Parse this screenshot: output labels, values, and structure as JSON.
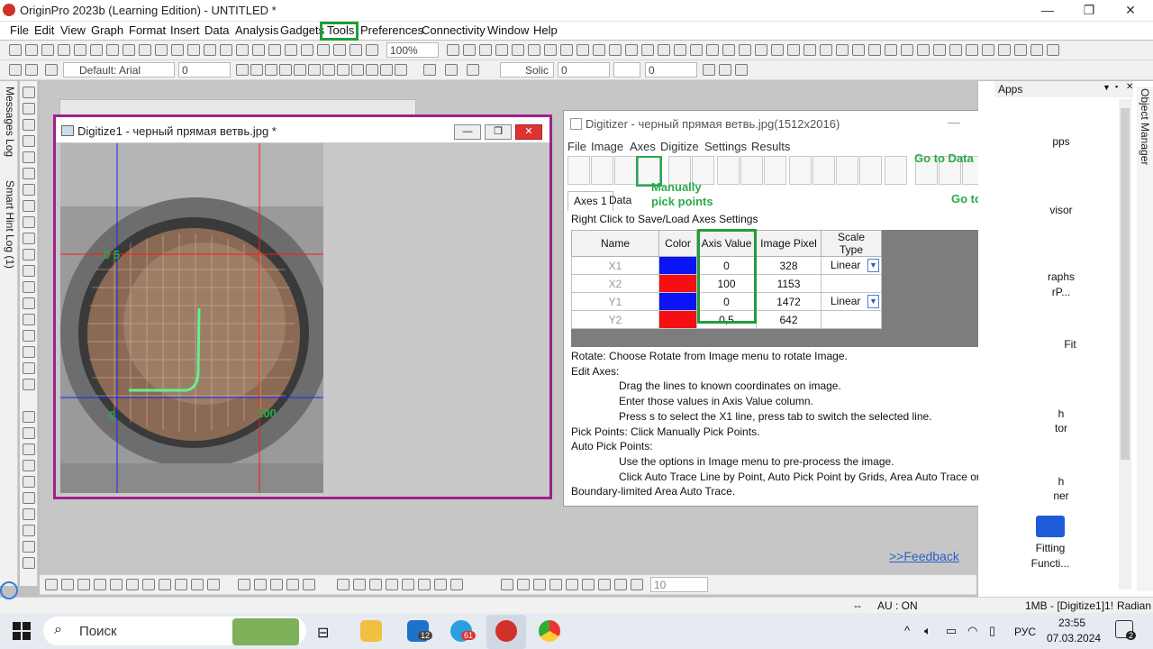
{
  "window": {
    "title": "OriginPro 2023b (Learning Edition) - UNTITLED *"
  },
  "menu": [
    "File",
    "Edit",
    "View",
    "Graph",
    "Format",
    "Insert",
    "Data",
    "Analysis",
    "Gadgets",
    "Tools",
    "Preferences",
    "Connectivity",
    "Window",
    "Help"
  ],
  "toolbar": {
    "zoom": "100%",
    "font": "Default: Arial",
    "font_size": "0",
    "line_style": "Solic",
    "line_width": "0",
    "bottom_size": "10"
  },
  "left_dock": {
    "messages": "Messages Log",
    "smart_hint": "Smart Hint Log (1)"
  },
  "image_window": {
    "title": "Digitize1 - черный прямая ветвь.jpg *",
    "labels": {
      "x_min": "0",
      "x_max": "100",
      "y_top": "0 5"
    }
  },
  "digitizer": {
    "title": "Digitizer - черный прямая ветвь.jpg(1512x2016)",
    "menu": [
      "File",
      "Image",
      "Axes",
      "Digitize",
      "Settings",
      "Results"
    ],
    "tabs": [
      "Axes 1",
      "Data"
    ],
    "hint": "Right Click to Save/Load Axes Settings",
    "columns": [
      "Name",
      "Color",
      "Axis Value",
      "Image Pixel",
      "Scale Type"
    ],
    "rows": [
      {
        "name": "X1",
        "color": "#0a14f5",
        "value": "0",
        "pixel": "328",
        "scale": "Linear"
      },
      {
        "name": "X2",
        "color": "#f50f12",
        "value": "100",
        "pixel": "1153",
        "scale": ""
      },
      {
        "name": "Y1",
        "color": "#0a14f5",
        "value": "0",
        "pixel": "1472",
        "scale": "Linear"
      },
      {
        "name": "Y2",
        "color": "#f50f12",
        "value": "0,5",
        "pixel": "642",
        "scale": ""
      }
    ],
    "help": [
      "Rotate: Choose Rotate from Image menu to rotate Image.",
      "Edit Axes:",
      "Drag the lines to known coordinates on image.",
      "Enter those values in Axis Value column.",
      "Press s to select the X1 line, press tab to switch the selected line.",
      "Pick Points: Click Manually Pick Points.",
      "Auto Pick Points:",
      "Use the options in Image menu to pre-process the image.",
      "Click Auto Trace Line by Point, Auto Pick Point by Grids, Area Auto Trace or",
      "Boundary-limited Area Auto Trace."
    ],
    "annotations": {
      "manual": "Manually\npick points",
      "go_data": "Go to Data",
      "go_graph": "Go to Graph"
    }
  },
  "apps": {
    "title": "Apps",
    "items": [
      "pps",
      "visor",
      "raphs",
      "rP...",
      "Fit",
      "h",
      "tor",
      "h",
      "ner",
      "Fitting",
      "Functi..."
    ],
    "side_label": "Object Manager"
  },
  "feedback": ">>Feedback",
  "status": {
    "mode": "--",
    "au": "AU : ON",
    "info": "1MB - [Digitize1]1!",
    "unit": "Radian"
  },
  "taskbar": {
    "search": "Поиск",
    "lang": "РУС",
    "time": "23:55",
    "date": "07.03.2024",
    "mail_badge": "12",
    "tg_badge": "61",
    "notif": "2"
  }
}
